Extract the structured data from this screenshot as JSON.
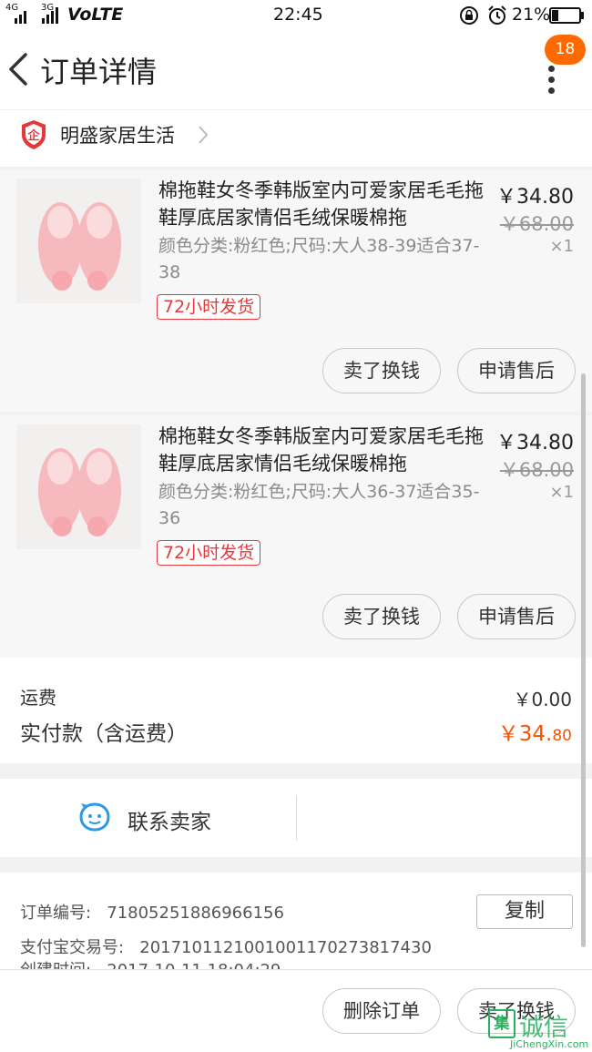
{
  "status_bar": {
    "signal_1": "4G",
    "signal_2": "3G",
    "network": "VoLTE",
    "time": "22:45",
    "battery": "21%"
  },
  "header": {
    "title": "订单详情",
    "badge_count": "18"
  },
  "shop": {
    "name": "明盛家居生活"
  },
  "items": [
    {
      "title": "棉拖鞋女冬季韩版室内可爱家居毛毛拖鞋厚底居家情侣毛绒保暖棉拖",
      "sku": "颜色分类:粉红色;尺码:大人38-39适合37-38",
      "tag": "72小时发货",
      "price": "￥34.80",
      "original_price": "￥68.00",
      "quantity": "×1",
      "actions": [
        "卖了换钱",
        "申请售后"
      ]
    },
    {
      "title": "棉拖鞋女冬季韩版室内可爱家居毛毛拖鞋厚底居家情侣毛绒保暖棉拖",
      "sku": "颜色分类:粉红色;尺码:大人36-37适合35-36",
      "tag": "72小时发货",
      "price": "￥34.80",
      "original_price": "￥68.00",
      "quantity": "×1",
      "actions": [
        "卖了换钱",
        "申请售后"
      ]
    }
  ],
  "summary": {
    "shipping_label": "运费",
    "shipping_value": "￥0.00",
    "paid_label": "实付款（含运费）",
    "paid_currency": "￥",
    "paid_int": "34.",
    "paid_dec": "80"
  },
  "contact": {
    "label": "联系卖家"
  },
  "order_info": {
    "order_no_label": "订单编号:",
    "order_no": "71805251886966156",
    "copy_label": "复制",
    "alipay_label": "支付宝交易号:",
    "alipay_no": "2017101121001001170273817430",
    "created_label": "创建时间:",
    "created_time": "2017-10-11 18:04:29"
  },
  "bottom_actions": [
    "删除订单",
    "卖了换钱"
  ],
  "watermark": {
    "glyph": "集",
    "cn": "诚信",
    "en": "JiChengXin.com"
  },
  "colors": {
    "accent": "#ff5000",
    "badge": "#ff6a00",
    "tag_red": "#e4393c",
    "contact_blue": "#2d9ae8"
  }
}
